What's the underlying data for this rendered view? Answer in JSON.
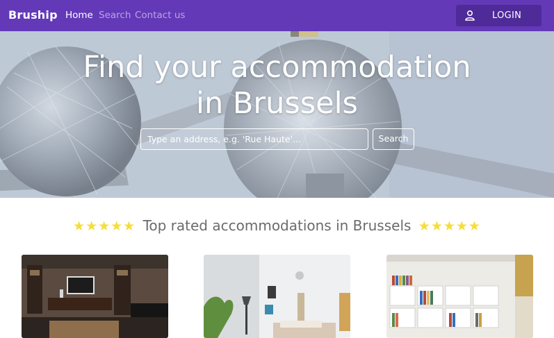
{
  "navbar": {
    "brand": "Bruship",
    "links": [
      {
        "label": "Home",
        "active": true
      },
      {
        "label": "Search",
        "active": false
      },
      {
        "label": "Contact us",
        "active": false
      }
    ],
    "login": {
      "label": "LOGIN",
      "icon": "user-icon"
    },
    "colors": {
      "bar": "#6339b8",
      "button": "#4f2a99"
    }
  },
  "hero": {
    "title_line1": "Find your accommodation",
    "title_line2": "in Brussels",
    "search": {
      "placeholder": "Type an address, e.g. 'Rue Haute'...",
      "button_label": "Search"
    }
  },
  "section": {
    "stars_left": "★★★★★",
    "title": "Top rated accommodations in Brussels",
    "stars_right": "★★★★★",
    "star_color": "#f5dd3a"
  },
  "cards": [
    {
      "image": "living-room-photo"
    },
    {
      "image": "bedroom-photo"
    },
    {
      "image": "bookshelf-room-photo"
    }
  ]
}
